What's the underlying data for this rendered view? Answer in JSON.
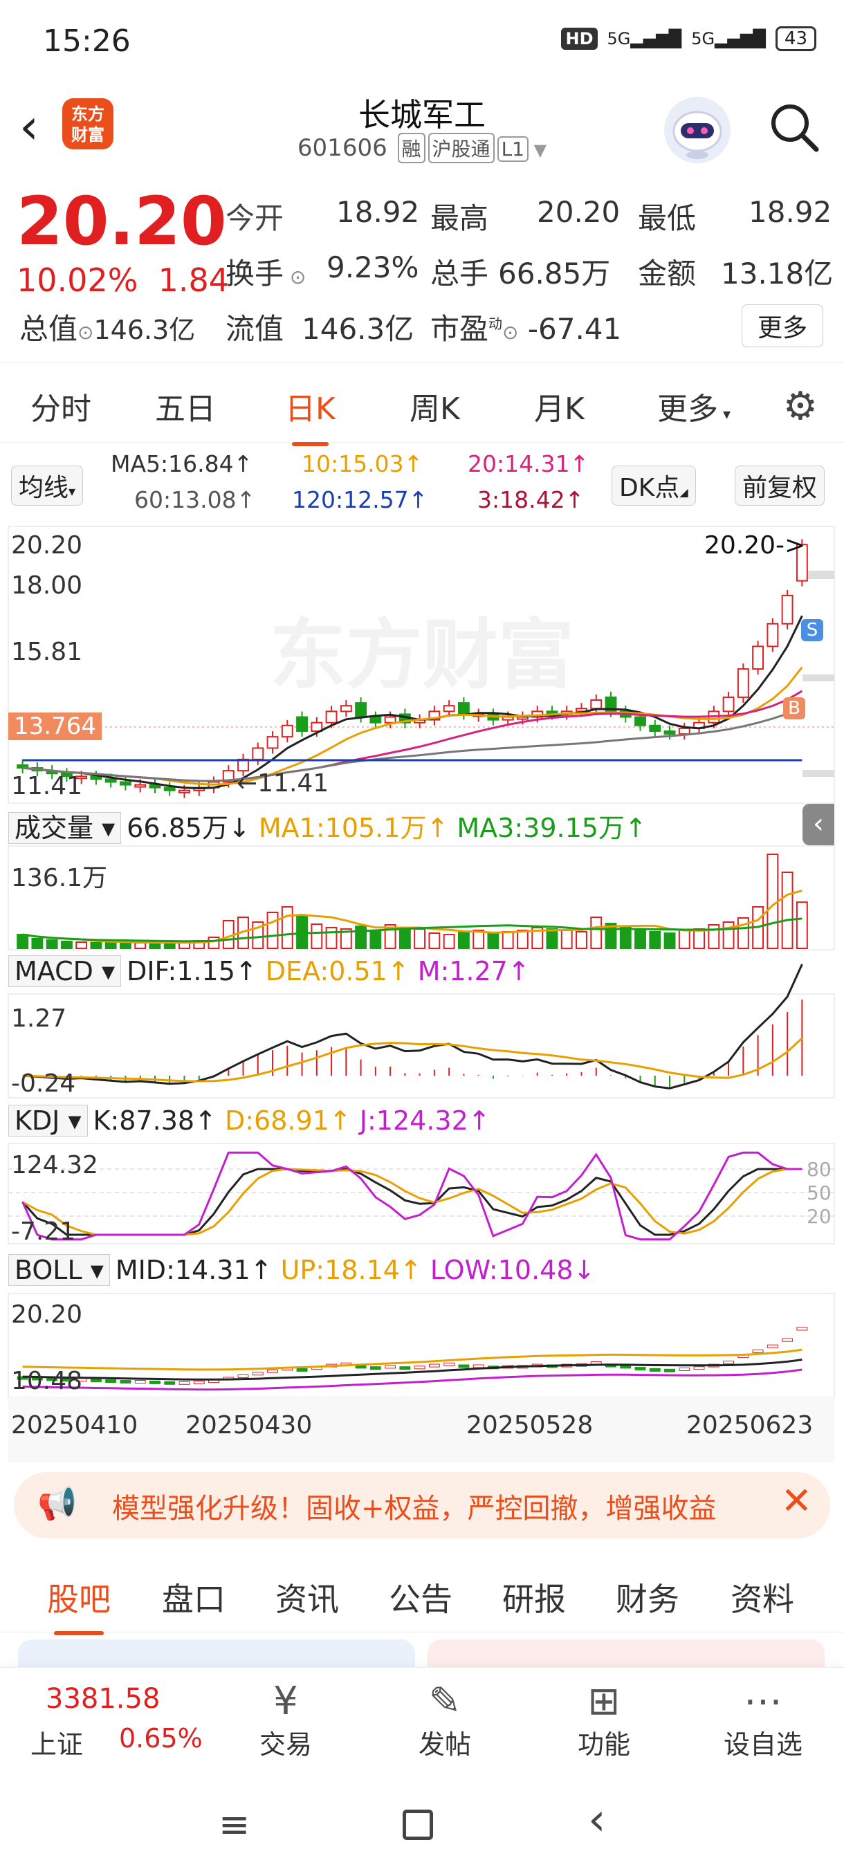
{
  "status": {
    "time": "15:26",
    "hd": "HD",
    "net1": "5G",
    "net2": "5G",
    "battery": "43"
  },
  "header": {
    "logo_text": "东方\n财富",
    "title": "长城军工",
    "code": "601606",
    "tags": [
      "融",
      "沪股通",
      "L1"
    ]
  },
  "quote": {
    "price": "20.20",
    "pct": "10.02%",
    "chg": "1.84",
    "open_l": "今开",
    "open": "18.92",
    "high_l": "最高",
    "high": "20.20",
    "low_l": "最低",
    "low": "18.92",
    "turn_l": "换手",
    "turn": "9.23%",
    "vol_l": "总手",
    "vol": "66.85万",
    "amt_l": "金额",
    "amt": "13.18亿",
    "mcap_l": "总值",
    "mcap": "146.3亿",
    "float_l": "流值",
    "float": "146.3亿",
    "pe_l": "市盈",
    "pe_sup": "动",
    "pe": "-67.41",
    "more": "更多"
  },
  "tabs": [
    "分时",
    "五日",
    "日K",
    "周K",
    "月K",
    "更多"
  ],
  "ma": {
    "label": "均线",
    "ma5": "MA5:16.84",
    "ma10": "10:15.03",
    "ma20": "20:14.31",
    "ma60": "60:13.08",
    "ma120": "120:12.57",
    "ma3": "3:18.42",
    "dk": "DK点",
    "fq": "前复权"
  },
  "kline": {
    "y_top": "20.20",
    "y2": "18.00",
    "y3": "15.81",
    "y4": "13.764",
    "y_bottom": "11.41",
    "last_label": "20.20->",
    "low_label": "11.41",
    "s_label": "S",
    "b_label": "B",
    "watermark": "东方财富"
  },
  "volume": {
    "label": "成交量",
    "val": "66.85万",
    "ma1": "MA1:105.1万",
    "ma3": "MA3:39.15万",
    "ymax": "136.1万"
  },
  "macd": {
    "label": "MACD",
    "dif": "DIF:1.15",
    "dea": "DEA:0.51",
    "m": "M:1.27",
    "ymax": "1.27",
    "ymin": "-0.24"
  },
  "kdj": {
    "label": "KDJ",
    "k": "K:87.38",
    "d": "D:68.91",
    "j": "J:124.32",
    "ymax": "124.32",
    "ymin": "-7.21",
    "l80": "80",
    "l50": "50",
    "l20": "20"
  },
  "boll": {
    "label": "BOLL",
    "mid": "MID:14.31",
    "up": "UP:18.14",
    "low": "LOW:10.48",
    "ymax": "20.20",
    "ymin": "10.48"
  },
  "dates": [
    "20250410",
    "20250430",
    "20250528",
    "20250623"
  ],
  "banner": {
    "text": "模型强化升级！固收+权益，严控回撤，增强收益"
  },
  "bottom_tabs": [
    "股吧",
    "盘口",
    "资讯",
    "公告",
    "研报",
    "财务",
    "资料"
  ],
  "bottom_bar": {
    "index_val": "3381.58",
    "index_name": "上证",
    "index_pct": "0.65%",
    "trade": "交易",
    "post": "发帖",
    "func": "功能",
    "watch": "设自选"
  },
  "colors": {
    "up": "#e02020",
    "down": "#1a9e1a",
    "accent": "#e94e1b"
  },
  "chart_data": {
    "type": "candlestick",
    "closes": [
      12.3,
      12.2,
      12.1,
      12.0,
      12.0,
      11.9,
      11.8,
      11.7,
      11.7,
      11.6,
      11.5,
      11.5,
      11.6,
      11.8,
      12.2,
      12.6,
      13.0,
      13.4,
      13.8,
      13.6,
      13.9,
      14.3,
      14.5,
      14.1,
      13.9,
      14.1,
      13.9,
      14.0,
      14.3,
      14.5,
      14.2,
      14.2,
      14.0,
      14.1,
      14.1,
      14.3,
      14.2,
      14.3,
      14.4,
      14.7,
      14.3,
      14.1,
      13.8,
      13.6,
      13.5,
      13.7,
      13.9,
      14.3,
      14.8,
      15.8,
      16.6,
      17.4,
      18.4,
      20.2
    ],
    "opens": [
      12.4,
      12.3,
      12.2,
      12.1,
      12.0,
      12.0,
      11.9,
      11.8,
      11.7,
      11.7,
      11.6,
      11.5,
      11.5,
      11.6,
      11.8,
      12.2,
      12.6,
      13.0,
      13.4,
      14.1,
      13.6,
      13.9,
      14.3,
      14.6,
      14.1,
      13.9,
      14.2,
      13.9,
      14.0,
      14.3,
      14.6,
      14.2,
      14.2,
      14.0,
      14.1,
      14.1,
      14.3,
      14.2,
      14.3,
      14.4,
      14.8,
      14.3,
      14.1,
      13.8,
      13.6,
      13.5,
      13.7,
      13.9,
      14.3,
      14.8,
      15.8,
      16.6,
      17.4,
      18.92
    ],
    "volume": [
      20,
      14,
      12,
      10,
      9,
      8,
      10,
      9,
      8,
      7,
      8,
      9,
      11,
      16,
      40,
      45,
      38,
      52,
      60,
      48,
      35,
      30,
      28,
      32,
      26,
      34,
      30,
      28,
      22,
      20,
      24,
      26,
      22,
      24,
      26,
      30,
      28,
      26,
      24,
      45,
      36,
      30,
      28,
      24,
      22,
      26,
      28,
      34,
      38,
      44,
      60,
      136,
      110,
      66.85
    ]
  }
}
